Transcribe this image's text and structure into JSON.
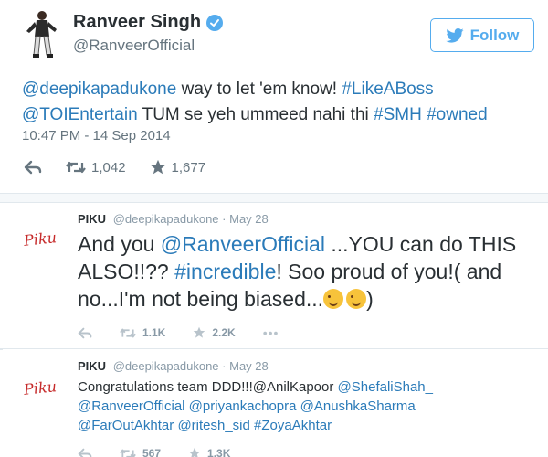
{
  "main_tweet": {
    "display_name": "Ranveer Singh",
    "handle": "@RanveerOfficial",
    "follow_label": "Follow",
    "text_parts": [
      "@deepikapadukone",
      " way to let 'em know! ",
      "#LikeABoss",
      "@TOIEntertain",
      " TUM se yeh ummeed nahi thi ",
      "#SMH",
      " ",
      "#owned"
    ],
    "timestamp": "10:47 PM - 14 Sep 2014",
    "retweets": "1,042",
    "favorites": "1,677"
  },
  "reply1": {
    "name": "PIKU",
    "handle": "@deepikapadukone",
    "date": "· May 28",
    "avatar_text": "Piku",
    "text_parts": [
      "And you ",
      "@RanveerOfficial",
      " ...YOU can do THIS ALSO!!?? ",
      "#incredible",
      "! Soo proud of you!( and no...I'm not being biased..."
    ],
    "retweets": "1.1K",
    "favorites": "2.2K",
    "more": "•••"
  },
  "reply2": {
    "name": "PIKU",
    "handle": "@deepikapadukone",
    "date": "· May 28",
    "avatar_text": "Piku",
    "text_parts": [
      "Congratulations team DDD!!!@AnilKapoor  ",
      "@ShefaliShah_",
      "@RanveerOfficial",
      "@priyankachopra",
      "@AnushkaSharma",
      "@FarOutAkhtar",
      "@ritesh_sid",
      "#ZoyaAkhtar"
    ],
    "retweets": "567",
    "favorites": "1.3K"
  },
  "colors": {
    "link": "#2b7bb9",
    "follow": "#55acee",
    "verified": "#55acee",
    "muted": "#8899a6"
  }
}
